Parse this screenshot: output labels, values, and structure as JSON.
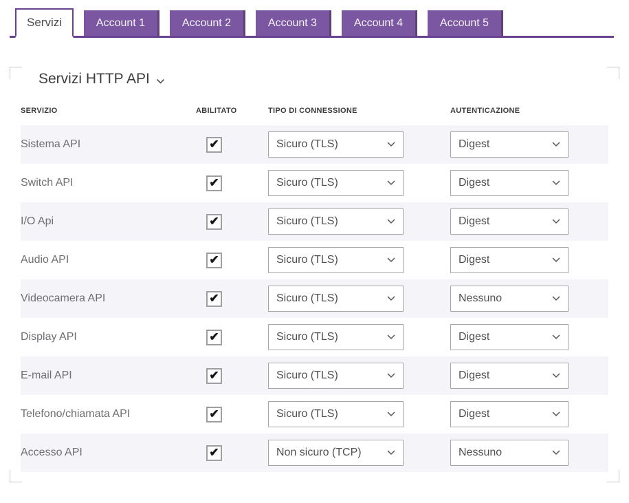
{
  "tabs": {
    "items": [
      {
        "label": "Servizi",
        "active": true
      },
      {
        "label": "Account 1",
        "active": false
      },
      {
        "label": "Account 2",
        "active": false
      },
      {
        "label": "Account 3",
        "active": false
      },
      {
        "label": "Account 4",
        "active": false
      },
      {
        "label": "Account 5",
        "active": false
      }
    ]
  },
  "panel": {
    "title": "Servizi HTTP API"
  },
  "table": {
    "headers": {
      "service": "SERVIZIO",
      "enabled": "ABILITATO",
      "connection": "TIPO DI CONNESSIONE",
      "auth": "AUTENTICAZIONE"
    },
    "rows": [
      {
        "service": "Sistema API",
        "enabled": true,
        "connection": "Sicuro (TLS)",
        "auth": "Digest"
      },
      {
        "service": "Switch API",
        "enabled": true,
        "connection": "Sicuro (TLS)",
        "auth": "Digest"
      },
      {
        "service": "I/O Api",
        "enabled": true,
        "connection": "Sicuro (TLS)",
        "auth": "Digest"
      },
      {
        "service": "Audio API",
        "enabled": true,
        "connection": "Sicuro (TLS)",
        "auth": "Digest"
      },
      {
        "service": "Videocamera API",
        "enabled": true,
        "connection": "Sicuro (TLS)",
        "auth": "Nessuno"
      },
      {
        "service": "Display API",
        "enabled": true,
        "connection": "Sicuro (TLS)",
        "auth": "Digest"
      },
      {
        "service": "E-mail API",
        "enabled": true,
        "connection": "Sicuro (TLS)",
        "auth": "Digest"
      },
      {
        "service": "Telefono/chiamata API",
        "enabled": true,
        "connection": "Sicuro (TLS)",
        "auth": "Digest"
      },
      {
        "service": "Accesso API",
        "enabled": true,
        "connection": "Non sicuro (TCP)",
        "auth": "Nessuno"
      }
    ]
  },
  "icons": {
    "checkmark": "✔",
    "section_chevron": "⌄"
  },
  "colors": {
    "accent_purple": "#7a57a0",
    "accent_purple_dark": "#6b4191",
    "tab_shadow": "#5e4277",
    "row_alt": "#f5f4f8"
  }
}
